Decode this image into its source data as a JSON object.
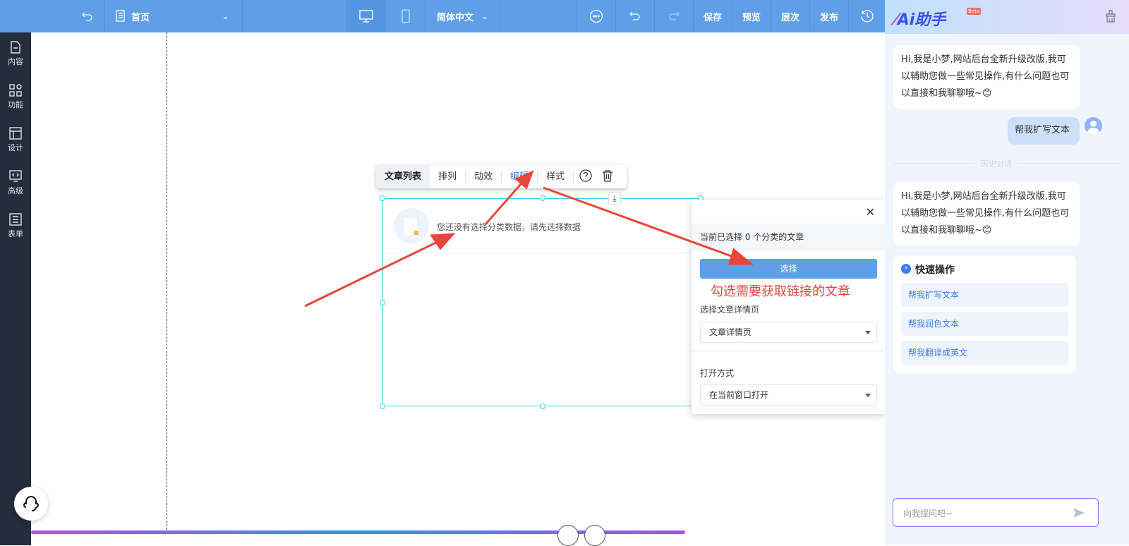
{
  "topbar": {
    "page": "首页",
    "language": "简体中文",
    "save": "保存",
    "preview": "预览",
    "layers": "层次",
    "publish": "发布"
  },
  "sidebar": {
    "items": [
      {
        "label": "内容",
        "icon": "file-icon"
      },
      {
        "label": "功能",
        "icon": "grid-icon"
      },
      {
        "label": "设计",
        "icon": "layout-icon"
      },
      {
        "label": "高级",
        "icon": "code-monitor-icon"
      },
      {
        "label": "表单",
        "icon": "list-icon"
      }
    ]
  },
  "toolbar": {
    "title": "文章列表",
    "items": [
      "排列",
      "动效",
      "编辑",
      "样式"
    ]
  },
  "component": {
    "empty_text": "您还没有选择分类数据，请先选择数据"
  },
  "popup": {
    "status": "当前已选择 0 个分类的文章",
    "select_button": "选择",
    "annotation": "勾选需要获取链接的文章",
    "detail_label": "选择文章详情页",
    "detail_value": "文章详情页",
    "open_label": "打开方式",
    "open_value": "在当前窗口打开"
  },
  "assistant": {
    "title": "Ai助手",
    "badge": "Beta",
    "greeting": "Hi,我是小梦,网站后台全新升级改版,我可以辅助您做一些常见操作,有什么问题也可以直接和我聊聊哦~😊",
    "user_message": "帮我扩写文本",
    "history_divider": "历史对话",
    "greeting2": "Hi,我是小梦,网站后台全新升级改版,我可以辅助您做一些常见操作,有什么问题也可以直接和我聊聊哦~😊",
    "quick_title": "快速操作",
    "quick_items": [
      "帮我扩写文本",
      "帮我润色文本",
      "帮我翻译成英文"
    ],
    "input_placeholder": "向我提问吧~"
  },
  "colors": {
    "topbar": "#5f9fe8",
    "sidebar": "#232d3b",
    "accent": "#3a7bf0",
    "annotation": "#e8453c"
  }
}
